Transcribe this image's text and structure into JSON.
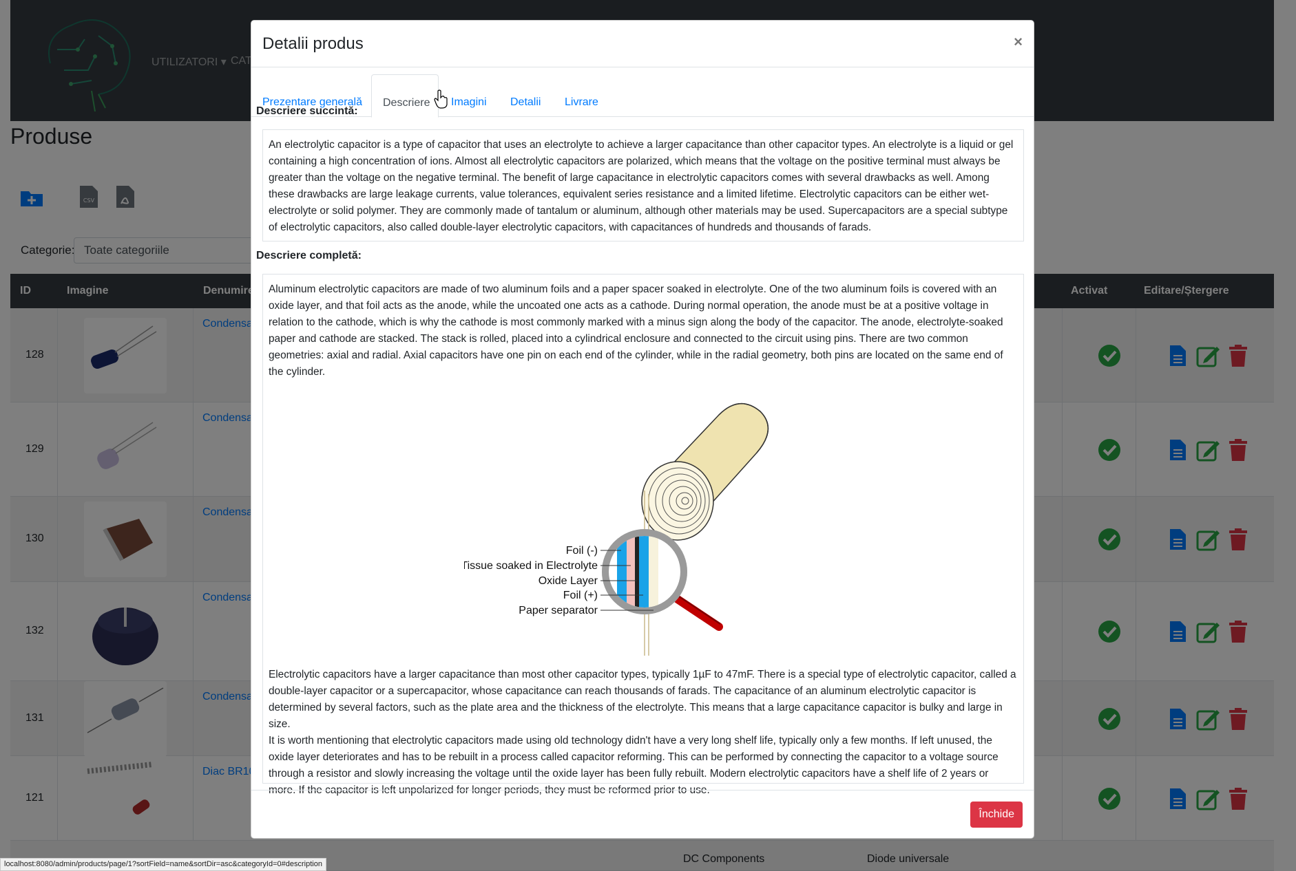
{
  "nav": {
    "users": "UTILIZATORI",
    "categories": "CATE"
  },
  "page": {
    "title": "Produse"
  },
  "toolbar": {
    "add_icon": "folder-plus-icon",
    "csv_icon": "csv-file-icon",
    "pdf_icon": "pdf-file-icon",
    "csv_text": "CSV"
  },
  "filter": {
    "label": "Categorie:",
    "value": "Toate categoriile"
  },
  "table": {
    "headers": {
      "id": "ID",
      "image": "Imagine",
      "name": "Denumire",
      "active": "Activat",
      "actions": "Editare/Ștergere"
    },
    "rows": [
      {
        "id": "128",
        "name": "Condensa"
      },
      {
        "id": "129",
        "name": "Condensa"
      },
      {
        "id": "130",
        "name": "Condensa"
      },
      {
        "id": "132",
        "name": "Condensa"
      },
      {
        "id": "131",
        "name": "Condensa"
      },
      {
        "id": "121",
        "name": "Diac BR10"
      }
    ],
    "partial_row": {
      "brand": "DC Components",
      "category": "Diode universale"
    }
  },
  "modal": {
    "title": "Detalii produs",
    "close_symbol": "×",
    "tabs": [
      "Prezentare generală",
      "Descriere",
      "Imagini",
      "Detalii",
      "Livrare"
    ],
    "short_label": "Descriere succintă:",
    "short_text": "An electrolytic capacitor is a type of capacitor that uses an electrolyte to achieve a larger capacitance than other capacitor types. An electrolyte is a liquid or gel containing a high concentration of ions. Almost all electrolytic capacitors are polarized, which means that the voltage on the positive terminal must always be greater than the voltage on the negative terminal. The benefit of large capacitance in electrolytic capacitors comes with several drawbacks as well. Among these drawbacks are large leakage currents, value tolerances, equivalent series resistance and a limited lifetime. Electrolytic capacitors can be either wet-electrolyte or solid polymer. They are commonly made of tantalum or aluminum, although other materials may be used. Supercapacitors are a special subtype of electrolytic capacitors, also called double-layer electrolytic capacitors, with capacitances of hundreds and thousands of farads.",
    "full_label": "Descriere completă:",
    "full_text_1": "Aluminum electrolytic capacitors are made of two aluminum foils and a paper spacer soaked in electrolyte. One of the two aluminum foils is covered with an oxide layer, and that foil acts as the anode, while the uncoated one acts as a cathode. During normal operation, the anode must be at a positive voltage in relation to the cathode, which is why the cathode is most commonly marked with a minus sign along the body of the capacitor. The anode, electrolyte-soaked paper and cathode are stacked. The stack is rolled, placed into a cylindrical enclosure and connected to the circuit using pins. There are two common geometries: axial and radial. Axial capacitors have one pin on each end of the cylinder, while in the radial geometry, both pins are located on the same end of the cylinder.",
    "figure_labels": [
      "Foil (-)",
      "Tissue soaked in Electrolyte",
      "Oxide Layer",
      "Foil (+)",
      "Paper separator"
    ],
    "full_text_2": "Electrolytic capacitors have a larger capacitance than most other capacitor types, typically 1µF to 47mF. There is a special type of electrolytic capacitor, called a double-layer capacitor or a supercapacitor, whose capacitance can reach thousands of farads. The capacitance of an aluminum electrolytic capacitor is determined by several factors, such as the plate area and the thickness of the electrolyte. This means that a large capacitance  capacitor is bulky and large in size.",
    "full_text_3": "It is worth mentioning that electrolytic capacitors made using old technology didn't have a very long shelf life, typically only a few months. If left unused, the oxide layer deteriorates and has to be rebuilt in a process called capacitor reforming. This can be performed by connecting the capacitor to a voltage source through a resistor and slowly increasing the voltage until the oxide layer has been fully rebuilt. Modern electrolytic capacitors have a shelf life of 2 years or more. If the capacitor is left unpolarized for longer periods, they must be reformed prior to use.",
    "close_button": "Închide"
  },
  "status_bar": {
    "url": "localhost:8080/admin/products/page/1?sortField=name&sortDir=asc&categoryId=0#description"
  },
  "colors": {
    "navbar": "#343a40",
    "link": "#007bff",
    "danger": "#dc3545",
    "success": "#28a745",
    "edit_green": "#28a745",
    "doc_blue": "#007bff"
  }
}
